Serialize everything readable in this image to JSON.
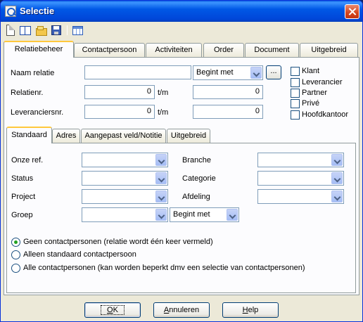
{
  "window": {
    "title": "Selectie"
  },
  "toolbar": {
    "icons": [
      "new-document-icon",
      "address-book-icon",
      "open-folder-icon",
      "save-icon",
      "table-icon"
    ]
  },
  "tabs_top": [
    {
      "label": "Relatiebeheer",
      "active": true
    },
    {
      "label": "Contactpersoon",
      "active": false
    },
    {
      "label": "Activiteiten",
      "active": false
    },
    {
      "label": "Order",
      "active": false
    },
    {
      "label": "Document",
      "active": false
    },
    {
      "label": "Uitgebreid",
      "active": false
    }
  ],
  "form": {
    "naam_relatie_label": "Naam relatie",
    "naam_relatie_value": "",
    "match_mode": "Begint met",
    "dots_label": "...",
    "relatienr_label": "Relatienr.",
    "relatienr_from": "0",
    "relatienr_tm_label": "t/m",
    "relatienr_to": "0",
    "leveranciersnr_label": "Leveranciersnr.",
    "leveranciersnr_from": "0",
    "leveranciersnr_tm_label": "t/m",
    "leveranciersnr_to": "0"
  },
  "checkboxes": [
    {
      "label": "Klant",
      "checked": false
    },
    {
      "label": "Leverancier",
      "checked": false
    },
    {
      "label": "Partner",
      "checked": false
    },
    {
      "label": "Privé",
      "checked": false
    },
    {
      "label": "Hoofdkantoor",
      "checked": false
    }
  ],
  "tabs_inner": [
    {
      "label": "Standaard",
      "active": true
    },
    {
      "label": "Adres",
      "active": false
    },
    {
      "label": "Aangepast veld/Notitie",
      "active": false
    },
    {
      "label": "Uitgebreid",
      "active": false
    }
  ],
  "fields": {
    "onze_ref_label": "Onze ref.",
    "status_label": "Status",
    "project_label": "Project",
    "groep_label": "Groep",
    "groep_mode": "Begint met",
    "branche_label": "Branche",
    "categorie_label": "Categorie",
    "afdeling_label": "Afdeling"
  },
  "radios": [
    {
      "label": "Geen contactpersonen (relatie wordt één keer vermeld)",
      "checked": true
    },
    {
      "label": "Alleen standaard contactpersoon",
      "checked": false
    },
    {
      "label": "Alle contactpersonen (kan worden beperkt dmv een selectie van contactpersonen)",
      "checked": false
    }
  ],
  "buttons": {
    "ok_rest": "K",
    "ok_mnemonic": "O",
    "cancel_mnemonic": "A",
    "cancel_rest": "nnuleren",
    "help_mnemonic": "H",
    "help_rest": "elp"
  },
  "colors": {
    "titlebar": "#0058e6",
    "dialog_bg": "#ece9d8",
    "active_tab_accent": "#ffc83c",
    "radio_dot": "#21a121"
  }
}
